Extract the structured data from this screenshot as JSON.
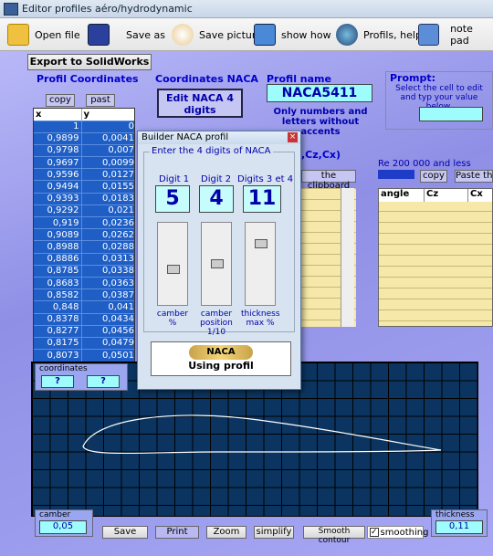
{
  "window": {
    "title": "Editor  profiles aéro/hydrodynamic"
  },
  "toolbar": {
    "open": "Open file",
    "saveas": "Save as",
    "savepic": "Save picture",
    "show": "show how",
    "help": "Profils, help",
    "notepad": "note pad"
  },
  "export": "Export to SolidWorks",
  "coords": {
    "title": "Profil Coordinates",
    "copy": "copy",
    "paste": "past",
    "col_x": "x",
    "col_y": "y",
    "rows": [
      [
        "1",
        "0"
      ],
      [
        "0,9899",
        "0,0041"
      ],
      [
        "0,9798",
        "0,007"
      ],
      [
        "0,9697",
        "0,0099"
      ],
      [
        "0,9596",
        "0,0127"
      ],
      [
        "0,9494",
        "0,0155"
      ],
      [
        "0,9393",
        "0,0183"
      ],
      [
        "0,9292",
        "0,021"
      ],
      [
        "0,919",
        "0,0236"
      ],
      [
        "0,9089",
        "0,0262"
      ],
      [
        "0,8988",
        "0,0288"
      ],
      [
        "0,8886",
        "0,0313"
      ],
      [
        "0,8785",
        "0,0338"
      ],
      [
        "0,8683",
        "0,0363"
      ],
      [
        "0,8582",
        "0,0387"
      ],
      [
        "0,848",
        "0,041"
      ],
      [
        "0,8378",
        "0,0434"
      ],
      [
        "0,8277",
        "0,0456"
      ],
      [
        "0,8175",
        "0,0479"
      ],
      [
        "0,8073",
        "0,0501"
      ]
    ]
  },
  "naca": {
    "title": "Coordinates NACA",
    "edit": "Edit NACA 4 digits"
  },
  "profil": {
    "title": "Profil name",
    "name": "NACA5411",
    "hint": "Only numbers and letters without accents"
  },
  "prompt": {
    "title": "Prompt:",
    "text": "Select the cell to edit and typ your value below."
  },
  "clip": {
    "label": ",Cz,Cx)",
    "btn": "the clipboard"
  },
  "re": {
    "label": "Re 200 000 and less",
    "copy": "copy",
    "paste": "Paste the",
    "cols": [
      "angle",
      "Cz",
      "Cx"
    ]
  },
  "dialog": {
    "title": "Builder NACA profil",
    "group": "Enter the 4 digits of NACA",
    "d1": "Digit 1",
    "d2": "Digit 2",
    "d34": "Digits 3 et 4",
    "v1": "5",
    "v2": "4",
    "v34": "11",
    "c1": "camber %",
    "c2": "camber position 1/10",
    "c3": "thickness max %",
    "logo": "NACA",
    "using": "Using profil"
  },
  "coordbox": {
    "label": "coordinates",
    "a": "?",
    "b": "?"
  },
  "bottom": {
    "camber_label": "camber",
    "camber": "0,05",
    "thick_label": "thickness",
    "thick": "0,11",
    "save": "Save",
    "print": "Print",
    "zoom": "Zoom",
    "simplify": "simplify",
    "smooth": "Smooth contour",
    "smoothing": "smoothing"
  }
}
